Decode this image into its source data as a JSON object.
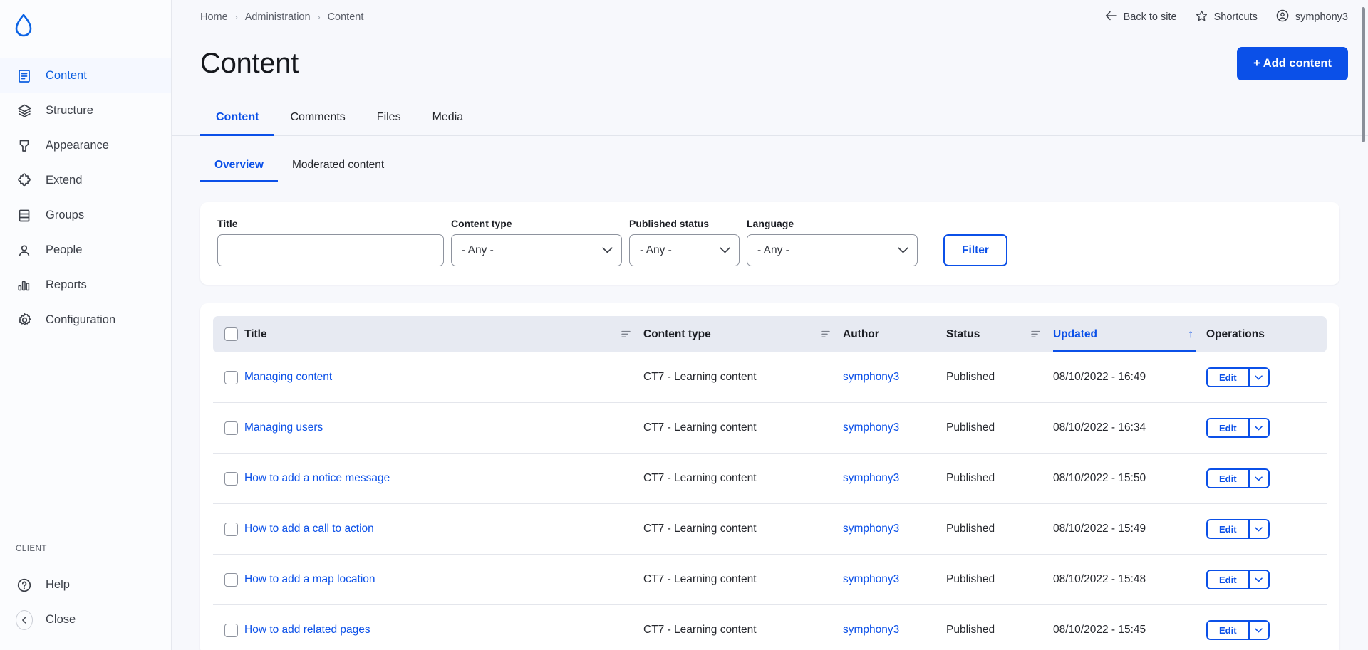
{
  "sidebar": {
    "logo_name": "drupal-drop-logo",
    "items": [
      {
        "label": "Content",
        "icon": "document-icon",
        "active": true
      },
      {
        "label": "Structure",
        "icon": "layers-icon",
        "active": false
      },
      {
        "label": "Appearance",
        "icon": "paintbrush-icon",
        "active": false
      },
      {
        "label": "Extend",
        "icon": "puzzle-icon",
        "active": false
      },
      {
        "label": "Groups",
        "icon": "groups-icon",
        "active": false
      },
      {
        "label": "People",
        "icon": "person-icon",
        "active": false
      },
      {
        "label": "Reports",
        "icon": "bar-chart-icon",
        "active": false
      },
      {
        "label": "Configuration",
        "icon": "gear-icon",
        "active": false
      }
    ],
    "section_label": "CLIENT",
    "help_label": "Help",
    "close_label": "Close"
  },
  "topbar": {
    "breadcrumb": [
      "Home",
      "Administration",
      "Content"
    ],
    "separator": "›",
    "back_to_site": "Back to site",
    "shortcuts": "Shortcuts",
    "account": "symphony3"
  },
  "page": {
    "title": "Content",
    "add_content_button": "+ Add content"
  },
  "tabs_primary": [
    {
      "label": "Content",
      "active": true
    },
    {
      "label": "Comments",
      "active": false
    },
    {
      "label": "Files",
      "active": false
    },
    {
      "label": "Media",
      "active": false
    }
  ],
  "tabs_secondary": [
    {
      "label": "Overview",
      "active": true
    },
    {
      "label": "Moderated content",
      "active": false
    }
  ],
  "filters": {
    "title": {
      "label": "Title",
      "value": "",
      "placeholder": ""
    },
    "content_type": {
      "label": "Content type",
      "value": "- Any -"
    },
    "published_status": {
      "label": "Published status",
      "value": "- Any -"
    },
    "language": {
      "label": "Language",
      "value": "- Any -"
    },
    "submit_label": "Filter"
  },
  "table": {
    "columns": [
      {
        "key": "select",
        "label": "",
        "sortable": false,
        "sorted": false
      },
      {
        "key": "title",
        "label": "Title",
        "sortable": true,
        "sorted": false
      },
      {
        "key": "ctype",
        "label": "Content type",
        "sortable": true,
        "sorted": false
      },
      {
        "key": "author",
        "label": "Author",
        "sortable": false,
        "sorted": false
      },
      {
        "key": "status",
        "label": "Status",
        "sortable": true,
        "sorted": false
      },
      {
        "key": "updated",
        "label": "Updated",
        "sortable": true,
        "sorted": true,
        "sort_direction": "asc",
        "sort_arrow": "↑"
      },
      {
        "key": "ops",
        "label": "Operations",
        "sortable": false,
        "sorted": false
      }
    ],
    "edit_label": "Edit",
    "rows": [
      {
        "title": "Managing content",
        "ctype": "CT7 - Learning content",
        "author": "symphony3",
        "status": "Published",
        "updated": "08/10/2022 - 16:49"
      },
      {
        "title": "Managing users",
        "ctype": "CT7 - Learning content",
        "author": "symphony3",
        "status": "Published",
        "updated": "08/10/2022 - 16:34"
      },
      {
        "title": "How to add a notice message",
        "ctype": "CT7 - Learning content",
        "author": "symphony3",
        "status": "Published",
        "updated": "08/10/2022 - 15:50"
      },
      {
        "title": "How to add a call to action",
        "ctype": "CT7 - Learning content",
        "author": "symphony3",
        "status": "Published",
        "updated": "08/10/2022 - 15:49"
      },
      {
        "title": "How to add a map location",
        "ctype": "CT7 - Learning content",
        "author": "symphony3",
        "status": "Published",
        "updated": "08/10/2022 - 15:48"
      },
      {
        "title": "How to add related pages",
        "ctype": "CT7 - Learning content",
        "author": "symphony3",
        "status": "Published",
        "updated": "08/10/2022 - 15:45"
      }
    ]
  },
  "colors": {
    "accent_blue": "#0b50e8",
    "page_background": "#f7f8fc",
    "sidebar_background": "#fbfcfe",
    "table_header_background": "#e7eaf2",
    "text_primary": "#232429"
  }
}
